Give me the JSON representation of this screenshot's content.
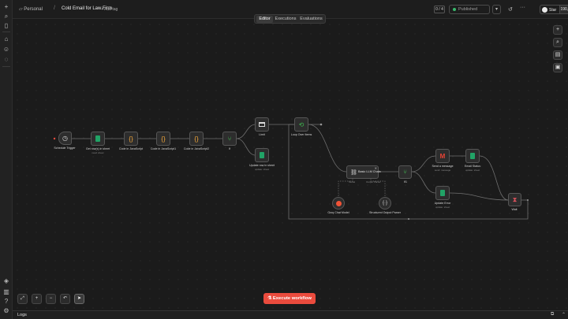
{
  "rail": {
    "top_icons": [
      "plus-icon",
      "search-icon",
      "panel-icon"
    ],
    "nav_icons": [
      "home-icon",
      "user-icon",
      "chat-icon"
    ],
    "bottom_icons": [
      "templates-icon",
      "insights-icon",
      "help-icon",
      "settings-icon"
    ]
  },
  "header": {
    "project": "Personal",
    "project_icon": "folder-icon",
    "crumb_sep": "/",
    "workflow_name": "Cold Email for Law Firm",
    "add_tag": "+ Add tag",
    "counter": "0 / 4",
    "publish_label": "Published",
    "publish_dot_color": "#39b86c",
    "publish_drop": "▾",
    "history_icon": "↺",
    "more_icon": "···",
    "github_star": "Star",
    "github_count": "190,901"
  },
  "tabs": [
    {
      "label": "Editor",
      "active": true
    },
    {
      "label": "Executions",
      "active": false
    },
    {
      "label": "Evaluations",
      "active": false
    }
  ],
  "nodes": {
    "schedule": {
      "label": "Schedule Trigger",
      "icon": "clock-icon"
    },
    "get_rows": {
      "label": "Get row(s) in sheet",
      "sub": "read: sheet"
    },
    "code1": {
      "label": "Code in JavaScript"
    },
    "code2": {
      "label": "Code in JavaScript1"
    },
    "code3": {
      "label": "Code in JavaScript2"
    },
    "if1": {
      "label": "If"
    },
    "limit": {
      "label": "Limit"
    },
    "update_row": {
      "label": "Update row in sheet",
      "sub": "update: sheet"
    },
    "loop": {
      "label": "Loop Over Items"
    },
    "agent": {
      "label": "Basic LLM Chain",
      "port_model": "Model",
      "port_parser": "Output Parser"
    },
    "groq": {
      "label": "Groq Chat Model"
    },
    "parser": {
      "label": "Structured Output Parser"
    },
    "if2": {
      "label": "If1"
    },
    "gmail": {
      "label": "Send a message",
      "sub": "send: message"
    },
    "email_status": {
      "label": "Email Status",
      "sub": "update: sheet"
    },
    "update_error": {
      "label": "Update Error",
      "sub": "update: sheet"
    },
    "wait": {
      "label": "Wait"
    }
  },
  "controls": {
    "zoom_fit": "⤢",
    "zoom_in": "+",
    "zoom_out": "−",
    "undo": "↶",
    "pointer": "➤"
  },
  "right_tools": [
    "+",
    "⌕",
    "▤",
    "▣"
  ],
  "execute_label": "Execute workflow",
  "execute_icon": "⚗",
  "logs_label": "Logs",
  "colors": {
    "accent": "#ea4b3d",
    "sheets_green": "#21a366",
    "code_orange": "#f0a53a",
    "if_green": "#3fb950",
    "gmail_red": "#ea4335",
    "wait_red": "#e0535d"
  }
}
